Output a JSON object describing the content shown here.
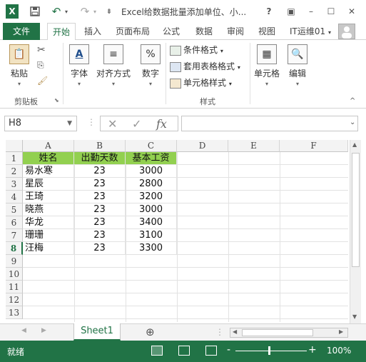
{
  "window": {
    "title": "Excel给数据批量添加单位、小...",
    "help": "?",
    "min": "–",
    "max": "☐",
    "close": "✕"
  },
  "qat": {
    "logo": "X",
    "save_icon": "save-icon",
    "undo": "↶",
    "redo": "↷",
    "customize": "⇟"
  },
  "tabs": [
    {
      "label": "文件"
    },
    {
      "label": "开始"
    },
    {
      "label": "插入"
    },
    {
      "label": "页面布局"
    },
    {
      "label": "公式"
    },
    {
      "label": "数据"
    },
    {
      "label": "审阅"
    },
    {
      "label": "视图"
    }
  ],
  "account": "IT运维01",
  "ribbon": {
    "clipboard": {
      "paste": "粘贴",
      "group": "剪贴板"
    },
    "font": {
      "label": "字体",
      "icon": "A"
    },
    "align": {
      "label": "对齐方式",
      "icon": "≡"
    },
    "number": {
      "label": "数字",
      "icon": "%"
    },
    "styles": {
      "cond": "条件格式",
      "table": "套用表格格式",
      "cell": "单元格样式",
      "group": "样式"
    },
    "cells": {
      "label": "单元格",
      "icon": "▦"
    },
    "edit": {
      "label": "编辑",
      "icon": "🔍"
    }
  },
  "formula": {
    "namebox": "H8",
    "fx": "fx",
    "cancel": "✕",
    "enter": "✓",
    "value": ""
  },
  "columns": [
    "A",
    "B",
    "C",
    "D",
    "E",
    "F"
  ],
  "rows": [
    "1",
    "2",
    "3",
    "4",
    "5",
    "6",
    "7",
    "8",
    "9",
    "10",
    "11",
    "12",
    "13"
  ],
  "table": {
    "headers": [
      "姓名",
      "出勤天数",
      "基本工资"
    ],
    "data": [
      [
        "易水寒",
        "23",
        "3000"
      ],
      [
        "星辰",
        "23",
        "2800"
      ],
      [
        "王琦",
        "23",
        "3200"
      ],
      [
        "晓燕",
        "23",
        "3000"
      ],
      [
        "华龙",
        "23",
        "3400"
      ],
      [
        "珊珊",
        "23",
        "3100"
      ],
      [
        "汪梅",
        "23",
        "3300"
      ]
    ]
  },
  "sheets": [
    {
      "label": "Sheet1"
    }
  ],
  "add_sheet": "⊕",
  "status": {
    "text": "就绪",
    "zoom": "100%",
    "minus": "-",
    "plus": "+"
  },
  "colors": {
    "accent": "#217346",
    "header_fill": "#92d050"
  }
}
